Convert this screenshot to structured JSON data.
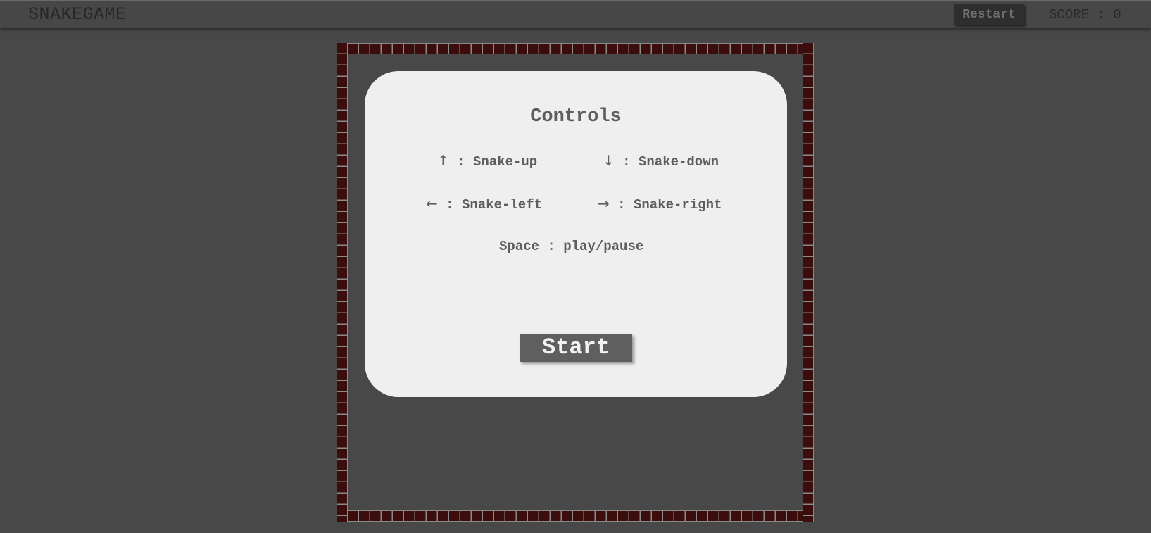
{
  "header": {
    "title": "SNAKEGAME",
    "restart_label": "Restart",
    "score_label": "SCORE",
    "score_separator": ":",
    "score_value": "0"
  },
  "modal": {
    "title": "Controls",
    "controls": [
      {
        "key_icon": "arrow-up",
        "glyph": "↑",
        "sep": ":",
        "action": "Snake-up"
      },
      {
        "key_icon": "arrow-down",
        "glyph": "↓",
        "sep": ":",
        "action": "Snake-down"
      },
      {
        "key_icon": "arrow-left",
        "glyph": "←",
        "sep": ":",
        "action": "Snake-left"
      },
      {
        "key_icon": "arrow-right",
        "glyph": "→",
        "sep": ":",
        "action": "Snake-right"
      }
    ],
    "space": {
      "key": "Space",
      "sep": ":",
      "action": "play/pause"
    },
    "start_label": "Start"
  },
  "colors": {
    "background": "#484848",
    "wall_brick": "#3b0d0d",
    "modal_bg": "#efefef",
    "button_bg": "#5f5f5f"
  }
}
